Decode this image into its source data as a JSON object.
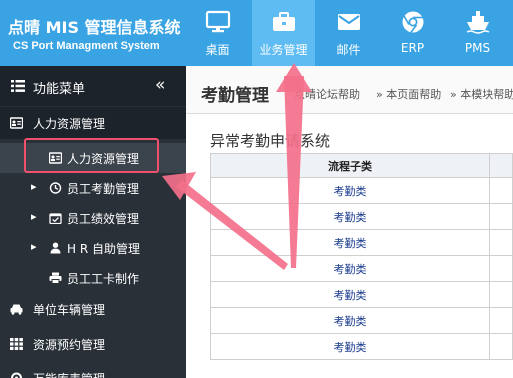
{
  "brand": {
    "title": "点晴 MIS 管理信息系统",
    "subtitle": "CS Port Managment System"
  },
  "nav": [
    {
      "label": "桌面",
      "icon": "monitor-icon",
      "active": false
    },
    {
      "label": "业务管理",
      "icon": "briefcase-icon",
      "active": true
    },
    {
      "label": "邮件",
      "icon": "envelope-icon",
      "active": false
    },
    {
      "label": "ERP",
      "icon": "chrome-icon",
      "active": false
    },
    {
      "label": "PMS",
      "icon": "ship-icon",
      "active": false
    }
  ],
  "sidebar": {
    "header_label": "功能菜单",
    "header_icon": "list-icon",
    "collapse_icon": "double-chevron-left-icon",
    "collapse_glyph": "«",
    "items": [
      {
        "label": "人力资源管理",
        "icon": "id-card-icon",
        "level": 1,
        "expanded": true
      },
      {
        "label": "人力资源管理",
        "icon": "id-card-icon",
        "level": 2,
        "current": true
      },
      {
        "label": "员工考勤管理",
        "icon": "clock-icon",
        "level": 2,
        "has_children": true
      },
      {
        "label": "员工绩效管理",
        "icon": "calendar-check-icon",
        "level": 2,
        "has_children": true
      },
      {
        "label": "H R 自助管理",
        "icon": "user-icon",
        "level": 2,
        "has_children": true
      },
      {
        "label": "员工工卡制作",
        "icon": "printer-icon",
        "level": 2
      },
      {
        "label": "单位车辆管理",
        "icon": "car-icon",
        "level": 1
      },
      {
        "label": "资源预约管理",
        "icon": "grid-icon",
        "level": 1
      },
      {
        "label": "万能库表管理",
        "icon": "settings-icon",
        "level": 1
      }
    ],
    "caret_glyph": "▸"
  },
  "main": {
    "page_title": "考勤管理",
    "breadcrumbs": [
      "点晴论坛帮助",
      "» 本页面帮助",
      "» 本模块帮助"
    ],
    "section_title": "异常考勤申请系统",
    "table": {
      "headers": [
        "流程子类",
        ""
      ],
      "rows": [
        [
          "考勤类",
          ""
        ],
        [
          "考勤类",
          ""
        ],
        [
          "考勤类",
          ""
        ],
        [
          "考勤类",
          ""
        ],
        [
          "考勤类",
          ""
        ],
        [
          "考勤类",
          ""
        ],
        [
          "考勤类",
          ""
        ]
      ]
    }
  },
  "colors": {
    "header_bg": "#3aa3e3",
    "nav_active_bg": "#5fbcf2",
    "sidebar_bg": "#293038",
    "annotation": "#f0506e"
  }
}
